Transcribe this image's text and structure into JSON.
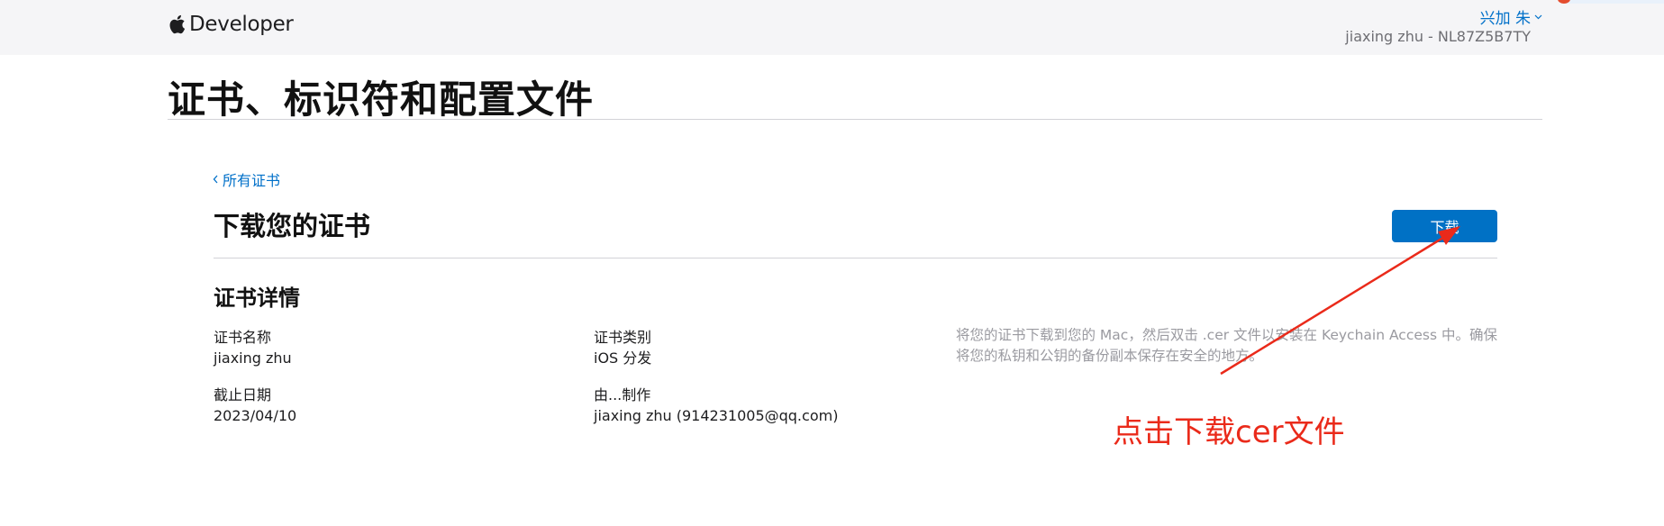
{
  "header": {
    "brand_label": "Developer",
    "account_name": "兴加 朱",
    "team_id": "jiaxing zhu - NL87Z5B7TY"
  },
  "page": {
    "title": "证书、标识符和配置文件"
  },
  "nav": {
    "back_label": "所有证书"
  },
  "section": {
    "title": "下载您的证书",
    "download_label": "下载"
  },
  "details": {
    "title": "证书详情",
    "cert_name_label": "证书名称",
    "cert_name_value": "jiaxing zhu",
    "cert_type_label": "证书类别",
    "cert_type_value": "iOS 分发",
    "expiry_label": "截止日期",
    "expiry_value": "2023/04/10",
    "created_by_label": "由...制作",
    "created_by_value": "jiaxing zhu (914231005@qq.com)",
    "hint": "将您的证书下载到您的 Mac，然后双击 .cer 文件以安装在 Keychain Access 中。确保将您的私钥和公钥的备份副本保存在安全的地方。"
  },
  "annotation": {
    "text": "点击下载cer文件",
    "color": "#ea2a1a"
  },
  "colors": {
    "accent": "#0070c9",
    "button_bg": "#0071c5",
    "topbar_bg": "#f5f5f7"
  },
  "icons": {
    "brand": "apple-logo-icon",
    "account_menu": "chevron-down-icon",
    "back": "chevron-left-icon"
  }
}
